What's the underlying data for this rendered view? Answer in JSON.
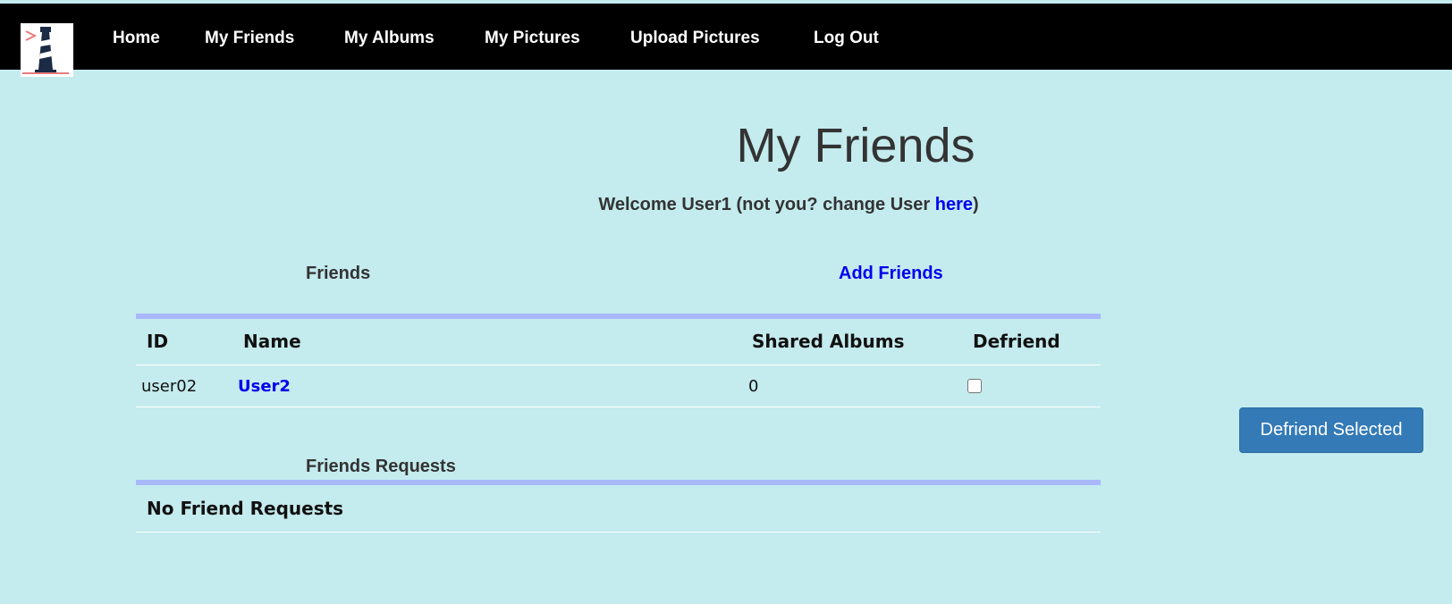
{
  "nav": {
    "items": [
      "Home",
      "My Friends",
      "My Albums",
      "My Pictures",
      "Upload Pictures",
      "Log Out"
    ]
  },
  "page": {
    "title": "My Friends",
    "welcome_prefix": "Welcome User1 (not you? change User ",
    "welcome_link": "here",
    "welcome_suffix": ")"
  },
  "friends": {
    "label": "Friends",
    "add_link": "Add Friends",
    "columns": [
      "ID",
      "Name",
      "Shared Albums",
      "Defriend"
    ],
    "rows": [
      {
        "id": "user02",
        "name": "User2",
        "shared_albums": "0",
        "defriend_checked": false
      }
    ]
  },
  "requests": {
    "label": "Friends Requests",
    "empty_text": "No Friend Requests"
  },
  "actions": {
    "defriend_button": "Defriend Selected"
  },
  "colors": {
    "background": "#c4ebee",
    "navbar": "#000000",
    "link": "#0000ee",
    "table_bar": "#a9b8fd",
    "button": "#337ab7"
  }
}
